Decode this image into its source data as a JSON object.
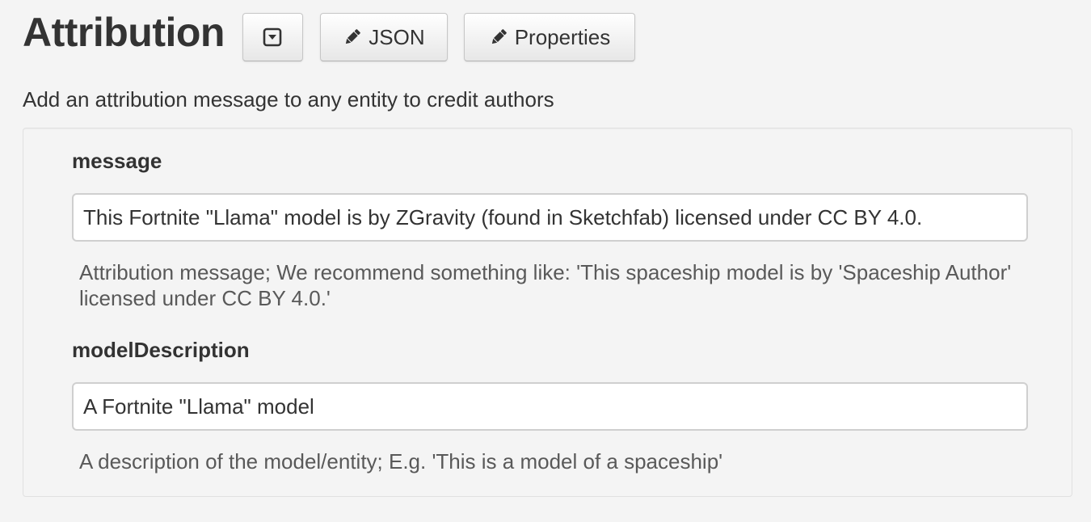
{
  "header": {
    "title": "Attribution",
    "buttons": {
      "collapse_icon": "caret-square-down-icon",
      "json_label": "JSON",
      "json_icon": "pencil-icon",
      "properties_label": "Properties",
      "properties_icon": "pencil-icon"
    }
  },
  "description": "Add an attribution message to any entity to credit authors",
  "fields": {
    "message": {
      "label": "message",
      "value": "This Fortnite \"Llama\" model is by ZGravity (found in Sketchfab) licensed under CC BY 4.0.",
      "help": "Attribution message; We recommend something like: 'This spaceship model is by 'Spaceship Author' licensed under CC BY 4.0.'"
    },
    "modelDescription": {
      "label": "modelDescription",
      "value": "A Fortnite \"Llama\" model",
      "help": "A description of the model/entity; E.g. 'This is a model of a spaceship'"
    }
  },
  "colors": {
    "background": "#f4f4f4",
    "text": "#333333",
    "help_text": "#595959",
    "input_border": "#cfcfcf"
  }
}
